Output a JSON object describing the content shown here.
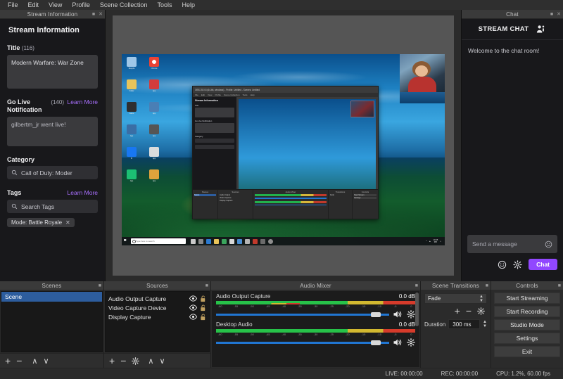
{
  "menubar": {
    "items": [
      {
        "label": "File"
      },
      {
        "label": "Edit"
      },
      {
        "label": "View"
      },
      {
        "label": "Profile"
      },
      {
        "label": "Scene Collection"
      },
      {
        "label": "Tools"
      },
      {
        "label": "Help"
      }
    ]
  },
  "stream_information": {
    "dock_title": "Stream Information",
    "heading": "Stream Information",
    "title": {
      "label": "Title",
      "count": "(116)",
      "value": "Modern Warfare: War Zone"
    },
    "go_live": {
      "label": "Go Live Notification",
      "count": "(140)",
      "link": "Learn More",
      "value": "gilbertm_jr went live!"
    },
    "category": {
      "label": "Category",
      "value": "Call of Duty: Moder",
      "icon": "search-icon"
    },
    "tags": {
      "label": "Tags",
      "link": "Learn More",
      "placeholder": "Search Tags",
      "icon": "search-icon",
      "chips": [
        {
          "label": "Mode: Battle Royale",
          "remove": "✕"
        }
      ]
    }
  },
  "chat": {
    "dock_title": "Chat",
    "header": "STREAM CHAT",
    "header_icon": "users-icon",
    "welcome": "Welcome to the chat room!",
    "input_placeholder": "Send a message",
    "input_icon": "emote-smiley-icon",
    "actions": {
      "emote_icon": "smiley-icon",
      "settings_icon": "gear-icon",
      "send_label": "Chat"
    },
    "accent_color": "#9147ff"
  },
  "scenes": {
    "dock_title": "Scenes",
    "items": [
      {
        "label": "Scene",
        "selected": true
      }
    ],
    "toolbar": [
      {
        "name": "add-scene-button",
        "glyph": "+"
      },
      {
        "name": "remove-scene-button",
        "glyph": "−"
      },
      {
        "name": "move-scene-up-button",
        "glyph": "∧"
      },
      {
        "name": "move-scene-down-button",
        "glyph": "∨"
      }
    ]
  },
  "sources": {
    "dock_title": "Sources",
    "items": [
      {
        "label": "Audio Output Capture",
        "visible": true,
        "locked": false
      },
      {
        "label": "Video Capture Device",
        "visible": true,
        "locked": false
      },
      {
        "label": "Display Capture",
        "visible": true,
        "locked": false
      }
    ],
    "toolbar": [
      {
        "name": "add-source-button",
        "glyph": "+"
      },
      {
        "name": "remove-source-button",
        "glyph": "−"
      },
      {
        "name": "source-properties-button",
        "glyph": "gear-icon"
      },
      {
        "name": "move-source-up-button",
        "glyph": "∧"
      },
      {
        "name": "move-source-down-button",
        "glyph": "∨"
      }
    ]
  },
  "audio_mixer": {
    "dock_title": "Audio Mixer",
    "tick_labels": [
      "-60",
      "-55",
      "-50",
      "-45",
      "-40",
      "-35",
      "-30",
      "-25",
      "-20",
      "-15",
      "-10",
      "-5",
      "0"
    ],
    "channels": [
      {
        "name": "Audio Output Capture",
        "db": "0.0 dB",
        "level_percent": 100,
        "mute_icon": "speaker-icon",
        "settings_icon": "gear-icon"
      },
      {
        "name": "Desktop Audio",
        "db": "0.0 dB",
        "level_percent": 100,
        "mute_icon": "speaker-icon",
        "settings_icon": "gear-icon"
      }
    ]
  },
  "scene_transitions": {
    "dock_title": "Scene Transitions",
    "transition": "Fade",
    "add_icon": "+",
    "remove_icon": "−",
    "properties_icon": "gear-icon",
    "duration_label": "Duration",
    "duration_value": "300 ms"
  },
  "controls": {
    "dock_title": "Controls",
    "buttons": [
      {
        "label": "Start Streaming",
        "name": "start-streaming-button"
      },
      {
        "label": "Start Recording",
        "name": "start-recording-button"
      },
      {
        "label": "Studio Mode",
        "name": "studio-mode-button"
      },
      {
        "label": "Settings",
        "name": "settings-button"
      },
      {
        "label": "Exit",
        "name": "exit-button"
      }
    ]
  },
  "statusbar": {
    "live": "LIVE: 00:00:00",
    "rec": "REC: 00:00:00",
    "cpu": "CPU: 1.2%, 60.00 fps"
  },
  "preview": {
    "inner_window_title": "OBS 25.0.8 (64-bit, windows) - Profile: Untitled - Scenes: Untitled",
    "inner_menu": [
      "File",
      "Edit",
      "View",
      "Profile",
      "Scene Collection",
      "Tools",
      "Help"
    ],
    "inner_panel_heading": "Stream Information",
    "inner_labels": {
      "title": "Title",
      "notification": "Go Live Notification",
      "category": "Category"
    },
    "taskbar_search_placeholder": "Type here to search"
  }
}
